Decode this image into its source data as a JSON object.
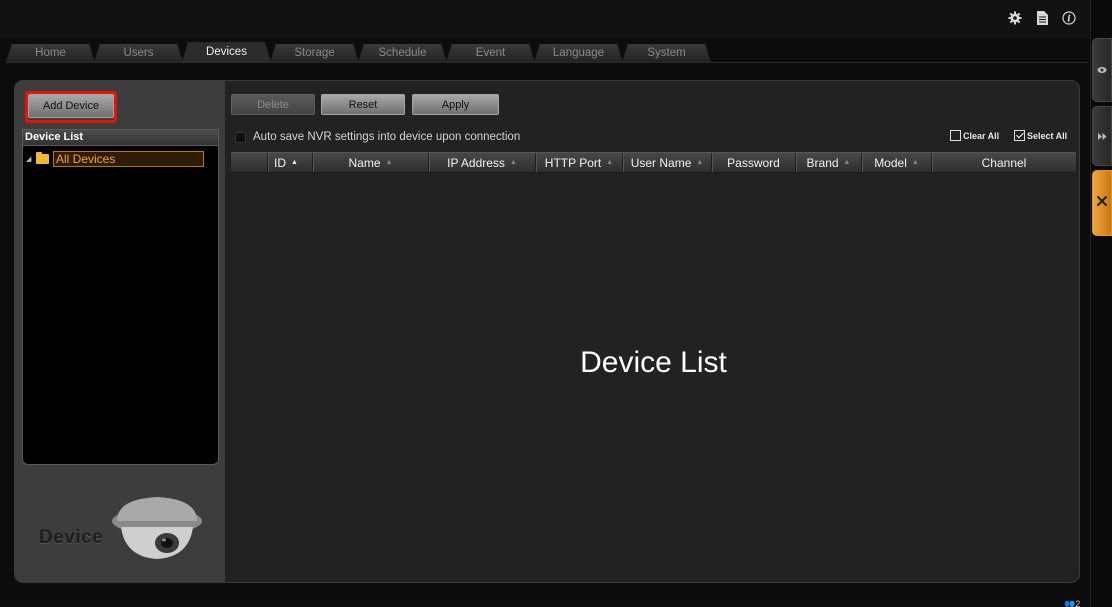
{
  "top_icons": [
    "settings-gear-icon",
    "document-icon",
    "info-icon"
  ],
  "tabs": [
    {
      "label": "Home",
      "active": false
    },
    {
      "label": "Users",
      "active": false
    },
    {
      "label": "Devices",
      "active": true
    },
    {
      "label": "Storage",
      "active": false
    },
    {
      "label": "Schedule",
      "active": false
    },
    {
      "label": "Event",
      "active": false
    },
    {
      "label": "Language",
      "active": false
    },
    {
      "label": "System",
      "active": false
    }
  ],
  "left_panel": {
    "add_device_label": "Add Device",
    "device_list_label": "Device List",
    "tree": [
      {
        "label": "All Devices",
        "selected": true
      }
    ],
    "logo_text": "Device"
  },
  "toolbar": {
    "delete_label": "Delete",
    "reset_label": "Reset",
    "apply_label": "Apply"
  },
  "autosave_label": "Auto save NVR settings into device upon connection",
  "clear_all_label": "Clear All",
  "select_all_label": "Select All",
  "columns": [
    {
      "label": "ID",
      "sorted": true
    },
    {
      "label": "Name",
      "sorted": false
    },
    {
      "label": "IP Address",
      "sorted": false
    },
    {
      "label": "HTTP Port",
      "sorted": false
    },
    {
      "label": "User Name",
      "sorted": false
    },
    {
      "label": "Password"
    },
    {
      "label": "Brand",
      "sorted": false
    },
    {
      "label": "Model",
      "sorted": false
    },
    {
      "label": "Channel"
    }
  ],
  "overlay_label": "Device List",
  "status": {
    "user_count": "2"
  },
  "colors": {
    "accent": "#e3982f",
    "highlight_box": "#e2140c",
    "tree_label": "#f2a524"
  }
}
